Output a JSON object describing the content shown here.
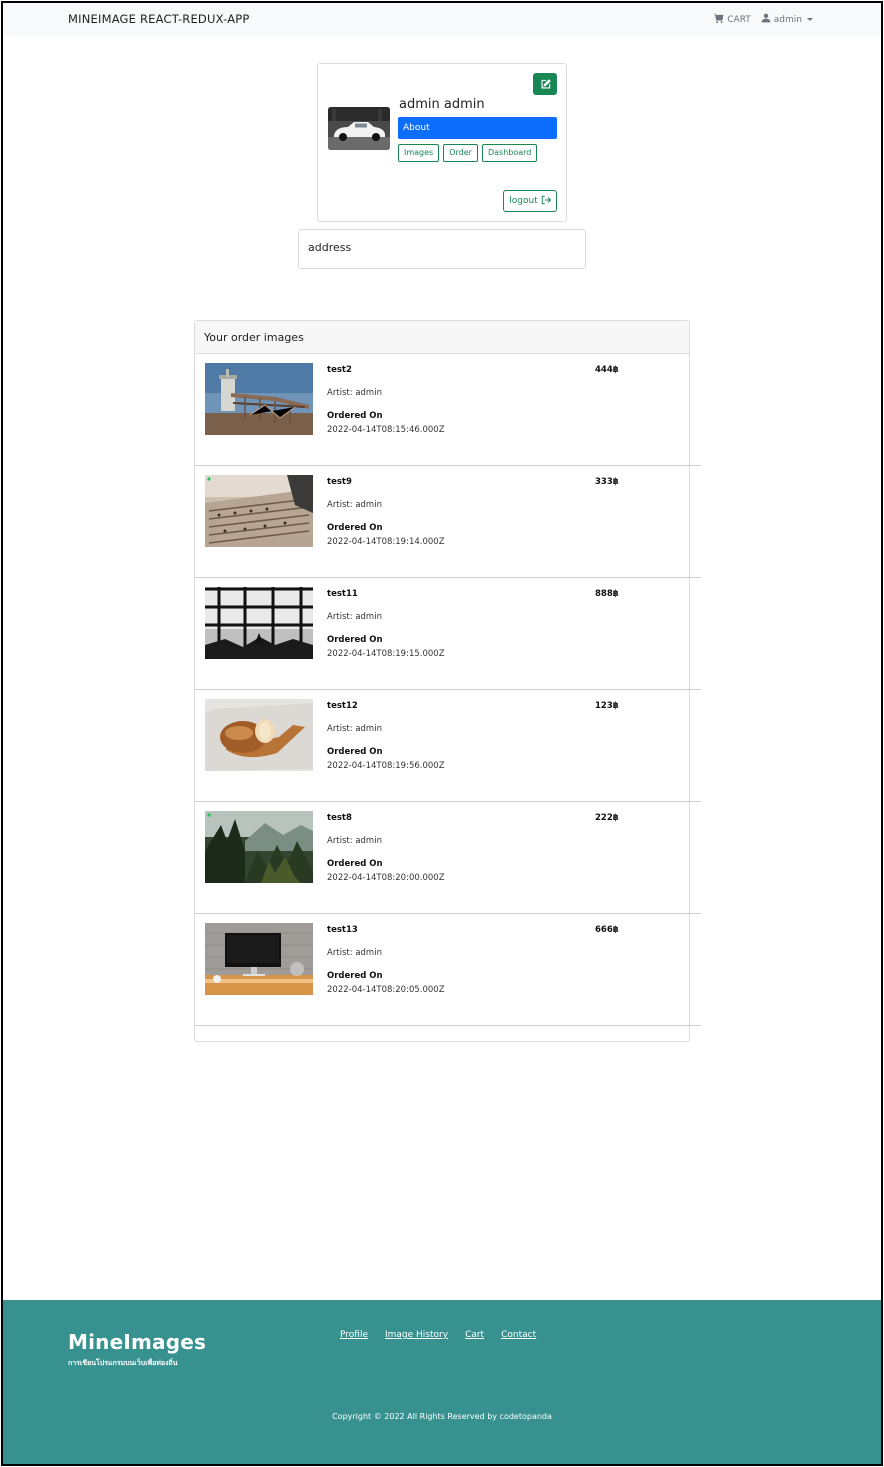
{
  "navbar": {
    "brand": "MINEIMAGE REACT-REDUX-APP",
    "cart_label": "CART",
    "user_label": "admin"
  },
  "profile": {
    "name": "admin admin",
    "about_label": "About",
    "tabs": [
      "Images",
      "Order",
      "Dashboard"
    ],
    "logout_label": "logout"
  },
  "address": {
    "label": "address"
  },
  "orders": {
    "header": "Your order images",
    "items": [
      {
        "title": "test2",
        "artist": "Artist: admin",
        "ordered_label": "Ordered On",
        "date": "2022-04-14T08:15:46.000Z",
        "price": "444฿",
        "image": "industrial-plant"
      },
      {
        "title": "test9",
        "artist": "Artist: admin",
        "ordered_label": "Ordered On",
        "date": "2022-04-14T08:19:14.000Z",
        "price": "333฿",
        "image": "mixing-console"
      },
      {
        "title": "test11",
        "artist": "Artist: admin",
        "ordered_label": "Ordered On",
        "date": "2022-04-14T08:19:15.000Z",
        "price": "888฿",
        "image": "window-silhouette"
      },
      {
        "title": "test12",
        "artist": "Artist: admin",
        "ordered_label": "Ordered On",
        "date": "2022-04-14T08:19:56.000Z",
        "price": "123฿",
        "image": "bread-loaf"
      },
      {
        "title": "test8",
        "artist": "Artist: admin",
        "ordered_label": "Ordered On",
        "date": "2022-04-14T08:20:00.000Z",
        "price": "222฿",
        "image": "forest-mountains"
      },
      {
        "title": "test13",
        "artist": "Artist: admin",
        "ordered_label": "Ordered On",
        "date": "2022-04-14T08:20:05.000Z",
        "price": "666฿",
        "image": "desk-monitor"
      }
    ]
  },
  "footer": {
    "logo": "MineImages",
    "tagline": "การเขียนโปรแกรมบนเว็บเพื่อท่องถิ่น",
    "links": [
      "Profile",
      "Image History",
      "Cart",
      "Contact"
    ],
    "copyright": "Copyright © 2022 All Rights Reserved by codetopanda"
  },
  "colors": {
    "primary": "#0d6efd",
    "success": "#198754",
    "footer_bg": "#36918f",
    "navbar_bg": "#f8f9fa"
  }
}
